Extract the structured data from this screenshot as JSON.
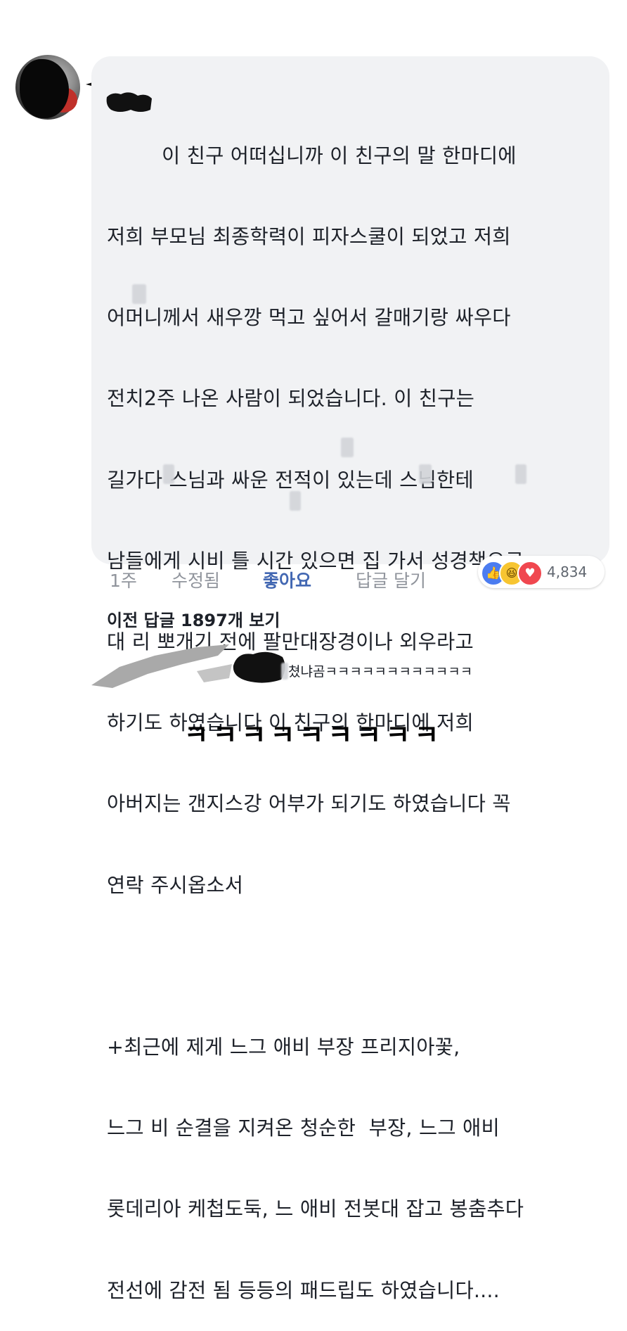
{
  "comment": {
    "lines": [
      "이 친구 어떠십니까 이 친구의 말 한마디에",
      "저희 부모님 최종학력이 피자스쿨이 되었고 저희",
      "어머니께서 새우깡 먹고 싶어서 갈매기랑 싸우다",
      "전치2주 나온 사람이 되었습니다. 이 친구는",
      "길가다 스님과 싸운 전적이 있는데 스님한테",
      "남들에게 시비 틀 시간 있으면 집 가서 성경책으로",
      "대 리 뽀개기 전에 팔만대장경이나 외우라고",
      "하기도 하였습니다 이 친구의 한마디에 저희",
      "아버지는 갠지스강 어부가 되기도 하였습니다 꼭",
      "연락 주시옵소서",
      "",
      "+최근에 제게 느그 애비 부장 프리지아꽃,",
      "느그 비 순결을 지켜온 청순한  부장, 느그 애비",
      "롯데리아 케첩도둑, 느 애비 전봇대 잡고 봉춤추다",
      "전선에 감전 됨 등등의 패드립도 하였습니다...."
    ]
  },
  "actions": {
    "time": "1주",
    "edited": "수정됨",
    "like": "좋아요",
    "reply": "답글 달기"
  },
  "reactions": {
    "count": "4,834",
    "icons": [
      "like-icon",
      "haha-icon",
      "love-icon"
    ]
  },
  "previous_replies": "이전 답글 1897개 보기",
  "reply": {
    "text": "쳤냐곰ㅋㅋㅋㅋㅋㅋㅋㅋㅋㅋㅋㅋ"
  },
  "caption": "ㅋㅋㅋㅋㅋㅋㅋㅋㅋ",
  "colors": {
    "bubble": "#f1f2f4",
    "like_blue": "#4267b2",
    "meta_gray": "#90949c"
  }
}
